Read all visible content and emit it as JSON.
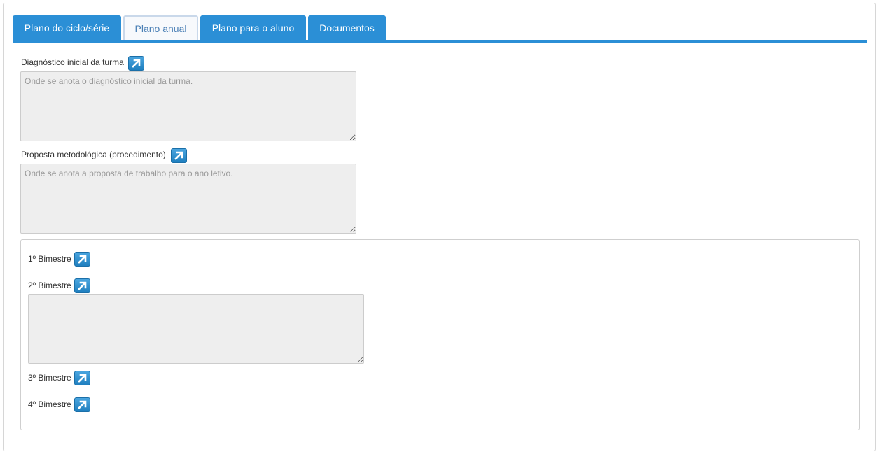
{
  "tabs": [
    {
      "label": "Plano do ciclo/série",
      "active": false
    },
    {
      "label": "Plano anual",
      "active": true
    },
    {
      "label": "Plano para o aluno",
      "active": false
    },
    {
      "label": "Documentos",
      "active": false
    }
  ],
  "diagnostico": {
    "label": "Diagnóstico inicial da turma",
    "placeholder": "Onde se anota o diagnóstico inicial da turma.",
    "value": ""
  },
  "proposta": {
    "label": "Proposta metodológica (procedimento)",
    "placeholder": "Onde se anota a proposta de trabalho para o ano letivo.",
    "value": ""
  },
  "bimestres": [
    {
      "label": "1º Bimestre"
    },
    {
      "label": "2º Bimestre",
      "value": ""
    },
    {
      "label": "3º Bimestre"
    },
    {
      "label": "4º Bimestre"
    }
  ],
  "icons": {
    "expand": "expand-arrow-icon"
  },
  "colors": {
    "accent": "#2b8fd6",
    "field_bg": "#eeeeee"
  }
}
